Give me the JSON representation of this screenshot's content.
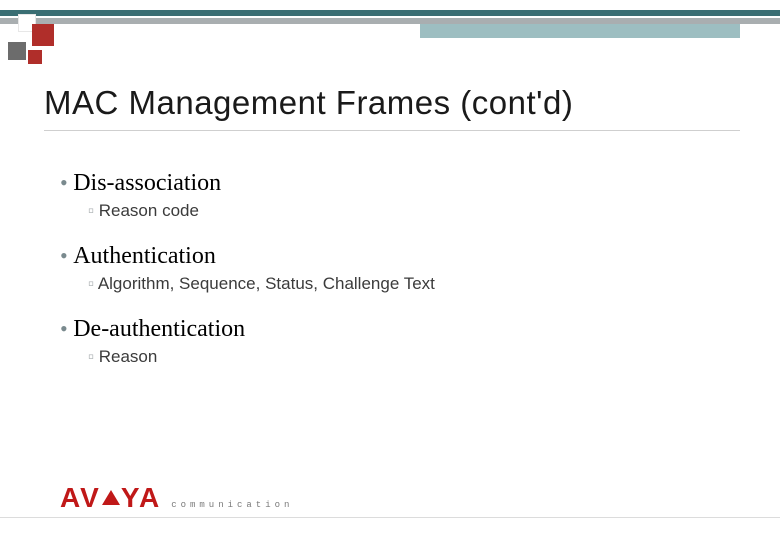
{
  "title": "MAC Management Frames (cont'd)",
  "bullets": [
    {
      "heading": "Dis-association",
      "sub": "Reason code"
    },
    {
      "heading": "Authentication",
      "sub": "Algorithm, Sequence, Status, Challenge Text"
    },
    {
      "heading": "De-authentication",
      "sub": "Reason"
    }
  ],
  "footer": {
    "brand": "AVAYA",
    "tagline": "communication"
  }
}
